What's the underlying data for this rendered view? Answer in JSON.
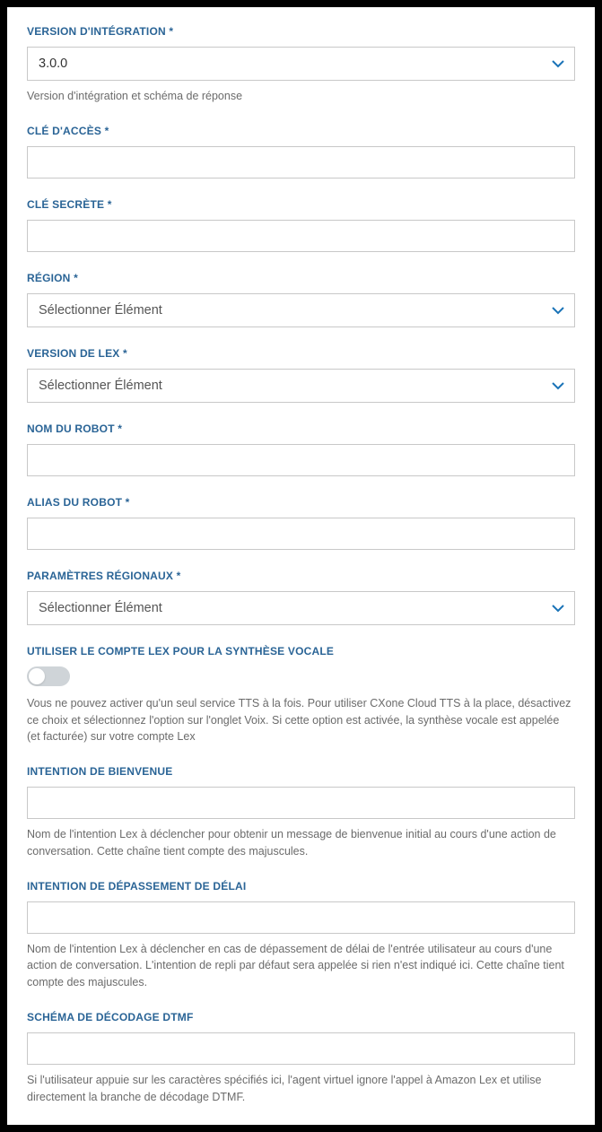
{
  "fields": {
    "integrationVersion": {
      "label": "VERSION D'INTÉGRATION *",
      "value": "3.0.0",
      "help": "Version d'intégration et schéma de réponse"
    },
    "accessKey": {
      "label": "CLÉ D'ACCÈS *",
      "value": ""
    },
    "secretKey": {
      "label": "CLÉ SECRÈTE *",
      "value": ""
    },
    "region": {
      "label": "RÉGION *",
      "placeholder": "Sélectionner Élément"
    },
    "lexVersion": {
      "label": "VERSION DE LEX *",
      "placeholder": "Sélectionner Élément"
    },
    "botName": {
      "label": "NOM DU ROBOT *",
      "value": ""
    },
    "botAlias": {
      "label": "ALIAS DU ROBOT *",
      "value": ""
    },
    "locale": {
      "label": "PARAMÈTRES RÉGIONAUX *",
      "placeholder": "Sélectionner Élément"
    },
    "useLexTTS": {
      "label": "UTILISER LE COMPTE LEX POUR LA SYNTHÈSE VOCALE",
      "help": "Vous ne pouvez activer qu'un seul service TTS à la fois. Pour utiliser CXone Cloud TTS à la place, désactivez ce choix et sélectionnez l'option sur l'onglet Voix. Si cette option est activée, la synthèse vocale est appelée (et facturée) sur votre compte Lex"
    },
    "welcomeIntent": {
      "label": "INTENTION DE BIENVENUE",
      "value": "",
      "help": "Nom de l'intention Lex à déclencher pour obtenir un message de bienvenue initial au cours d'une action de conversation. Cette chaîne tient compte des majuscules."
    },
    "timeoutIntent": {
      "label": "INTENTION DE DÉPASSEMENT DE DÉLAI",
      "value": "",
      "help": "Nom de l'intention Lex à déclencher en cas de dépassement de délai de l'entrée utilisateur au cours d'une action de conversation. L'intention de repli par défaut sera appelée si rien n'est indiqué ici. Cette chaîne tient compte des majuscules."
    },
    "dtmf": {
      "label": "SCHÉMA DE DÉCODAGE DTMF",
      "value": "",
      "help": "Si l'utilisateur appuie sur les caractères spécifiés ici, l'agent virtuel ignore l'appel à Amazon Lex et utilise directement la branche de décodage DTMF."
    }
  },
  "colors": {
    "labelColor": "#2a6496",
    "chevronColor": "#1a73b7"
  }
}
